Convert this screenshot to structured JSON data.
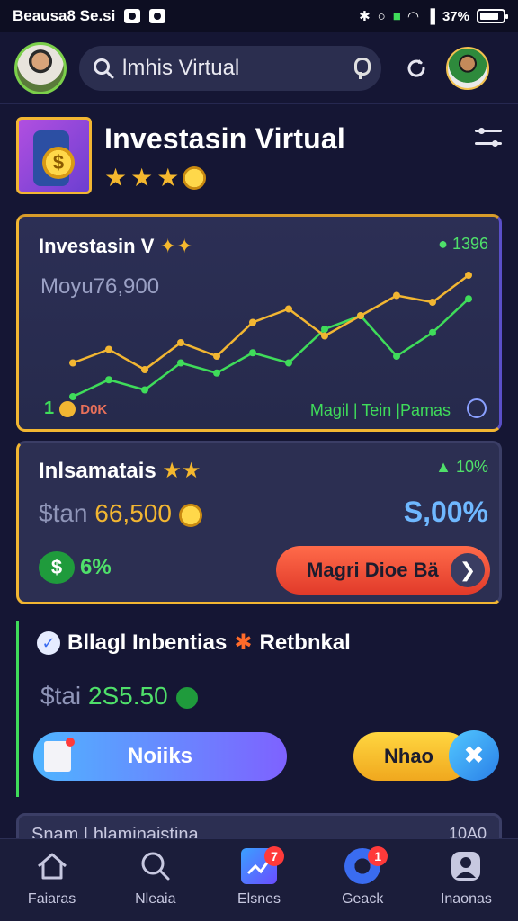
{
  "status_bar": {
    "left_text": "Beausa8 Se.si",
    "right_text": "37%"
  },
  "search": {
    "value": "lmhis Virtual"
  },
  "app": {
    "title": "Investasin Virtual"
  },
  "chart_card": {
    "title": "Investasin",
    "title_suffix": "V",
    "percent": "1396",
    "subtitle": "Moyu76,900",
    "left_label": "1",
    "left_label_suffix": "D0K",
    "right_label": "Magil | Tein |Pamas"
  },
  "chart_data": {
    "type": "line",
    "series": [
      {
        "values": [
          0,
          5,
          2,
          10,
          7,
          13,
          10,
          20,
          24,
          12,
          19,
          29
        ]
      },
      {
        "values": [
          10,
          14,
          8,
          16,
          12,
          22,
          26,
          18,
          24,
          30,
          28,
          36
        ]
      }
    ],
    "colors": [
      "#3fdc5a",
      "#f2b632"
    ]
  },
  "invest_card": {
    "title": "Inlsamatais",
    "percent": "10%",
    "amount_prefix": "$tan",
    "amount": "66,500",
    "value": "S,00%",
    "badge_pct": "6%",
    "cta_label": "Magri Dioe Bä"
  },
  "bonus": {
    "title": "Bllagl Inbentias",
    "title_suffix": "Retbnkal",
    "amount_prefix": "$tai",
    "amount": "2S5.50",
    "primary_button": "Noiiks",
    "secondary_button": "Nhao"
  },
  "peek_card": {
    "title": "Snam Lhlaminaistina",
    "value": "10A0"
  },
  "bottom_nav": [
    {
      "label": "Faiaras",
      "icon": "home-icon"
    },
    {
      "label": "Nleaia",
      "icon": "search-icon"
    },
    {
      "label": "Elsnes",
      "icon": "chart-icon",
      "badge": "7"
    },
    {
      "label": "Geack",
      "icon": "camera-icon",
      "badge": "1"
    },
    {
      "label": "Inaonas",
      "icon": "profile-icon"
    }
  ]
}
